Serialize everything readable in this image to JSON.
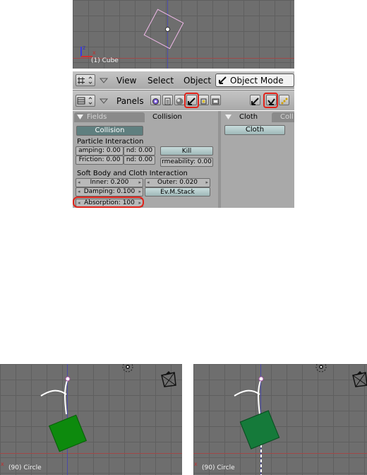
{
  "viewport_top": {
    "label": "(1) Cube"
  },
  "header": {
    "menus": [
      "View",
      "Select",
      "Object"
    ],
    "mode": "Object Mode"
  },
  "buttons_header": {
    "panels_label": "Panels"
  },
  "panel_left": {
    "tabs": [
      "Fields",
      "Collision"
    ],
    "collision_button": "Collision",
    "particle_interaction": "Particle Interaction",
    "damping_field": "amping: 0.00",
    "rnd_damping_field": "nd: 0.00",
    "friction_field": "Friction: 0.00",
    "rnd_friction_field": "nd: 0.00",
    "kill_button": "Kill",
    "permeability_field": "rmeability: 0.00",
    "softbody_cloth_interaction": "Soft Body and Cloth Interaction",
    "inner_field": "Inner: 0.200",
    "outer_field": "Outer: 0.020",
    "sb_damping_field": "Damping: 0.100",
    "evmstack_button": "Ev.M.Stack",
    "absorption_field": "Absorption: 100"
  },
  "panel_right": {
    "tabs": [
      "Cloth",
      "Coll"
    ],
    "cloth_button": "Cloth"
  },
  "viewport_bottom_left": {
    "label": "(90) Circle"
  },
  "viewport_bottom_right": {
    "label": "(90) Circle"
  },
  "colors": {
    "viewport_bg": "#6e6e6e",
    "panel_bg": "#a9a9a9",
    "highlight_red": "#e0231a",
    "cube_green_dark": "#0d8a0d",
    "cube_green_light": "#157a3a"
  }
}
